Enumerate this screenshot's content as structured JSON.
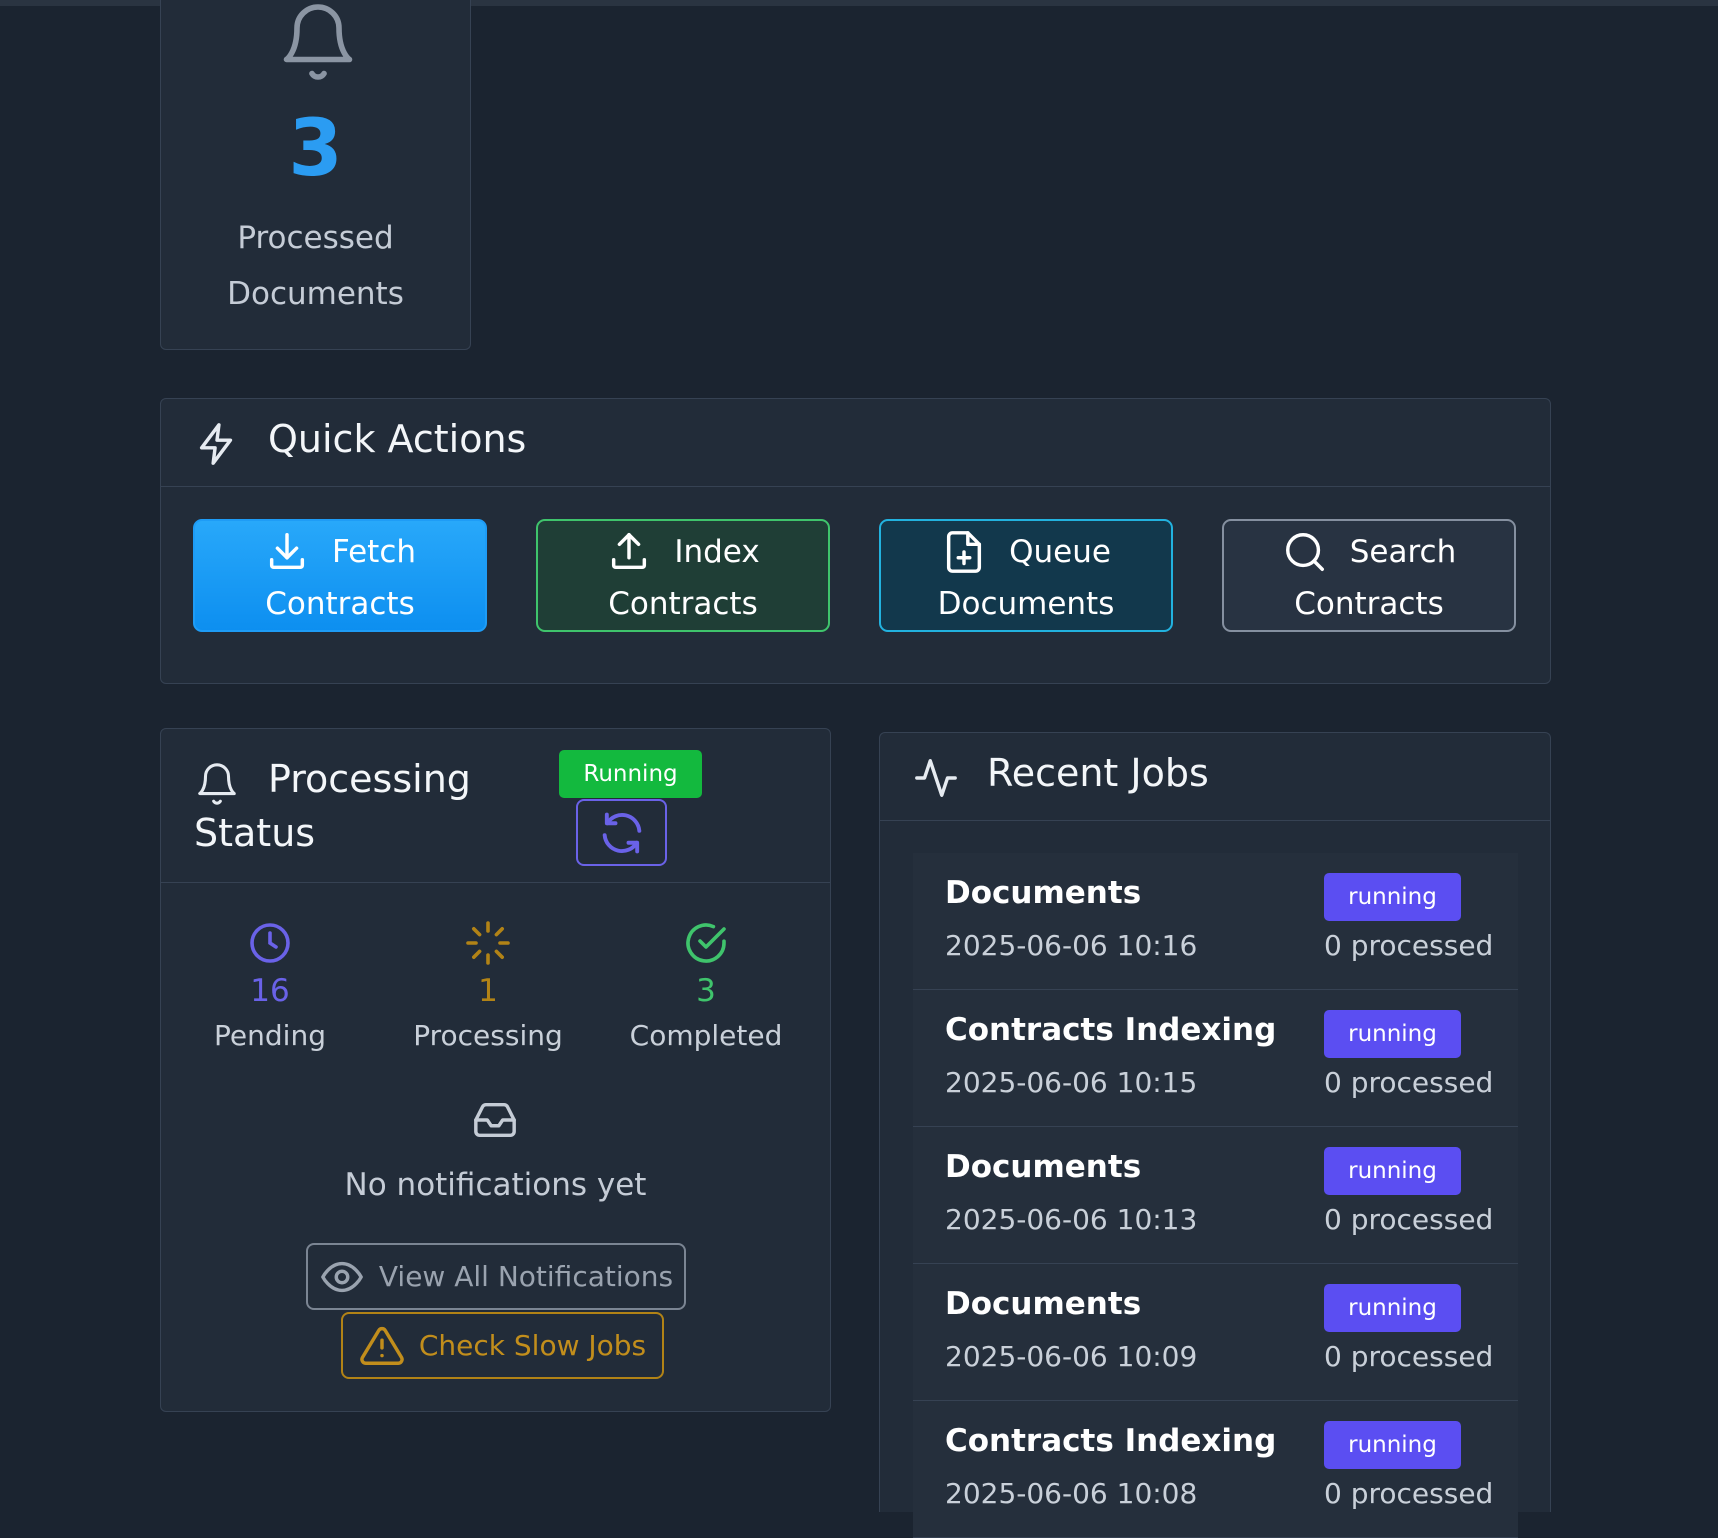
{
  "stat_card": {
    "icon": "bell-icon",
    "value": "3",
    "label_line1": "Processed",
    "label_line2": "Documents",
    "value_color": "#2b9cf2"
  },
  "quick_actions": {
    "title": "Quick Actions",
    "icon": "lightning-icon",
    "buttons": [
      {
        "line1": "Fetch",
        "line2": "Contracts",
        "icon": "download-icon"
      },
      {
        "line1": "Index",
        "line2": "Contracts",
        "icon": "upload-icon"
      },
      {
        "line1": "Queue",
        "line2": "Documents",
        "icon": "file-plus-icon"
      },
      {
        "line1": "Search",
        "line2": "Contracts",
        "icon": "search-icon"
      }
    ]
  },
  "processing_status": {
    "title_line1": "Processing",
    "title_line2": "Status",
    "icon": "bell-icon",
    "badge": "Running",
    "badge_color": "#13b93e",
    "stats": [
      {
        "value": "16",
        "label": "Pending",
        "icon": "clock-icon",
        "color": "#6a62e8"
      },
      {
        "value": "1",
        "label": "Processing",
        "icon": "spinner-icon",
        "color": "#b28316"
      },
      {
        "value": "3",
        "label": "Completed",
        "icon": "check-circle-icon",
        "color": "#3fc46c"
      }
    ],
    "empty_text": "No notifications yet",
    "view_all_label": "View All Notifications",
    "slow_jobs_label": "Check Slow Jobs"
  },
  "recent_jobs": {
    "title": "Recent Jobs",
    "icon": "activity-icon",
    "badge_color": "#5b4ef2",
    "jobs": [
      {
        "name": "Documents",
        "time": "2025-06-06 10:16",
        "status": "running",
        "processed": "0 processed"
      },
      {
        "name": "Contracts Indexing",
        "time": "2025-06-06 10:15",
        "status": "running",
        "processed": "0 processed"
      },
      {
        "name": "Documents",
        "time": "2025-06-06 10:13",
        "status": "running",
        "processed": "0 processed"
      },
      {
        "name": "Documents",
        "time": "2025-06-06 10:09",
        "status": "running",
        "processed": "0 processed"
      },
      {
        "name": "Contracts Indexing",
        "time": "2025-06-06 10:08",
        "status": "running",
        "processed": "0 processed"
      }
    ]
  }
}
